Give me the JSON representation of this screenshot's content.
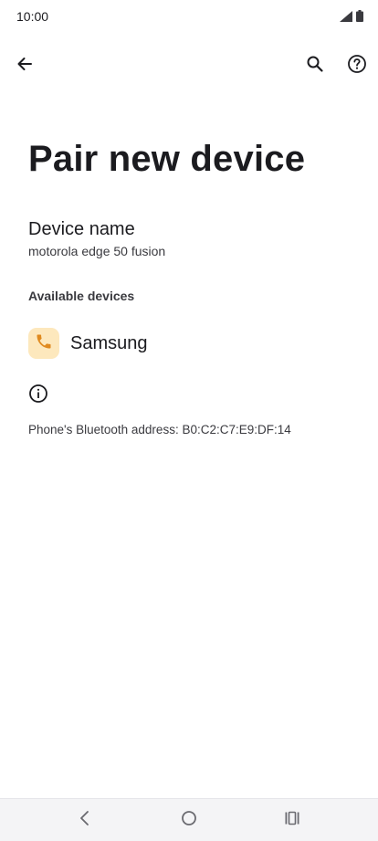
{
  "status_bar": {
    "time": "10:00",
    "icons": [
      "signal-icon",
      "battery-icon"
    ]
  },
  "toolbar": {
    "icons": [
      "back-arrow-icon",
      "search-icon",
      "help-icon"
    ]
  },
  "page": {
    "title": "Pair new device"
  },
  "device_name": {
    "title": "Device name",
    "value": "motorola edge 50 fusion"
  },
  "available_devices": {
    "header": "Available devices",
    "items": [
      {
        "label": "Samsung",
        "icon": "phone-icon",
        "icon_color": "#e08a1e",
        "icon_bg": "#fde8bd"
      }
    ]
  },
  "footer": {
    "info_icon": "info-icon",
    "bluetooth_address": "Phone's Bluetooth address: B0:C2:C7:E9:DF:14"
  },
  "nav_bar": {
    "icons": [
      "nav-back-icon",
      "nav-home-icon",
      "nav-recents-icon"
    ]
  },
  "colors": {
    "background": "#ffffff",
    "text_primary": "#1b1b1f",
    "text_secondary": "#3a3a3f",
    "nav_background": "#f4f4f6"
  }
}
